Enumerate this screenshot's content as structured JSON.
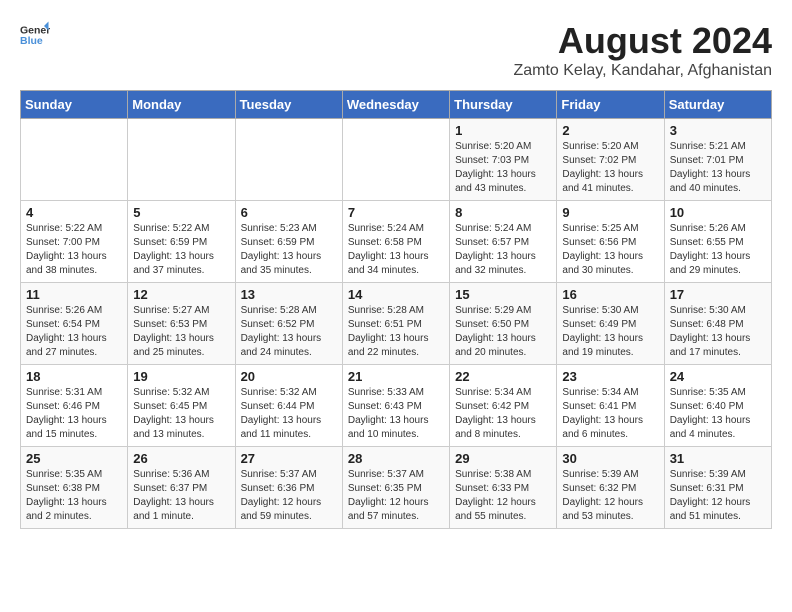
{
  "header": {
    "logo_general": "General",
    "logo_blue": "Blue",
    "title": "August 2024",
    "location": "Zamto Kelay, Kandahar, Afghanistan"
  },
  "weekdays": [
    "Sunday",
    "Monday",
    "Tuesday",
    "Wednesday",
    "Thursday",
    "Friday",
    "Saturday"
  ],
  "weeks": [
    [
      {
        "day": "",
        "info": ""
      },
      {
        "day": "",
        "info": ""
      },
      {
        "day": "",
        "info": ""
      },
      {
        "day": "",
        "info": ""
      },
      {
        "day": "1",
        "info": "Sunrise: 5:20 AM\nSunset: 7:03 PM\nDaylight: 13 hours\nand 43 minutes."
      },
      {
        "day": "2",
        "info": "Sunrise: 5:20 AM\nSunset: 7:02 PM\nDaylight: 13 hours\nand 41 minutes."
      },
      {
        "day": "3",
        "info": "Sunrise: 5:21 AM\nSunset: 7:01 PM\nDaylight: 13 hours\nand 40 minutes."
      }
    ],
    [
      {
        "day": "4",
        "info": "Sunrise: 5:22 AM\nSunset: 7:00 PM\nDaylight: 13 hours\nand 38 minutes."
      },
      {
        "day": "5",
        "info": "Sunrise: 5:22 AM\nSunset: 6:59 PM\nDaylight: 13 hours\nand 37 minutes."
      },
      {
        "day": "6",
        "info": "Sunrise: 5:23 AM\nSunset: 6:59 PM\nDaylight: 13 hours\nand 35 minutes."
      },
      {
        "day": "7",
        "info": "Sunrise: 5:24 AM\nSunset: 6:58 PM\nDaylight: 13 hours\nand 34 minutes."
      },
      {
        "day": "8",
        "info": "Sunrise: 5:24 AM\nSunset: 6:57 PM\nDaylight: 13 hours\nand 32 minutes."
      },
      {
        "day": "9",
        "info": "Sunrise: 5:25 AM\nSunset: 6:56 PM\nDaylight: 13 hours\nand 30 minutes."
      },
      {
        "day": "10",
        "info": "Sunrise: 5:26 AM\nSunset: 6:55 PM\nDaylight: 13 hours\nand 29 minutes."
      }
    ],
    [
      {
        "day": "11",
        "info": "Sunrise: 5:26 AM\nSunset: 6:54 PM\nDaylight: 13 hours\nand 27 minutes."
      },
      {
        "day": "12",
        "info": "Sunrise: 5:27 AM\nSunset: 6:53 PM\nDaylight: 13 hours\nand 25 minutes."
      },
      {
        "day": "13",
        "info": "Sunrise: 5:28 AM\nSunset: 6:52 PM\nDaylight: 13 hours\nand 24 minutes."
      },
      {
        "day": "14",
        "info": "Sunrise: 5:28 AM\nSunset: 6:51 PM\nDaylight: 13 hours\nand 22 minutes."
      },
      {
        "day": "15",
        "info": "Sunrise: 5:29 AM\nSunset: 6:50 PM\nDaylight: 13 hours\nand 20 minutes."
      },
      {
        "day": "16",
        "info": "Sunrise: 5:30 AM\nSunset: 6:49 PM\nDaylight: 13 hours\nand 19 minutes."
      },
      {
        "day": "17",
        "info": "Sunrise: 5:30 AM\nSunset: 6:48 PM\nDaylight: 13 hours\nand 17 minutes."
      }
    ],
    [
      {
        "day": "18",
        "info": "Sunrise: 5:31 AM\nSunset: 6:46 PM\nDaylight: 13 hours\nand 15 minutes."
      },
      {
        "day": "19",
        "info": "Sunrise: 5:32 AM\nSunset: 6:45 PM\nDaylight: 13 hours\nand 13 minutes."
      },
      {
        "day": "20",
        "info": "Sunrise: 5:32 AM\nSunset: 6:44 PM\nDaylight: 13 hours\nand 11 minutes."
      },
      {
        "day": "21",
        "info": "Sunrise: 5:33 AM\nSunset: 6:43 PM\nDaylight: 13 hours\nand 10 minutes."
      },
      {
        "day": "22",
        "info": "Sunrise: 5:34 AM\nSunset: 6:42 PM\nDaylight: 13 hours\nand 8 minutes."
      },
      {
        "day": "23",
        "info": "Sunrise: 5:34 AM\nSunset: 6:41 PM\nDaylight: 13 hours\nand 6 minutes."
      },
      {
        "day": "24",
        "info": "Sunrise: 5:35 AM\nSunset: 6:40 PM\nDaylight: 13 hours\nand 4 minutes."
      }
    ],
    [
      {
        "day": "25",
        "info": "Sunrise: 5:35 AM\nSunset: 6:38 PM\nDaylight: 13 hours\nand 2 minutes."
      },
      {
        "day": "26",
        "info": "Sunrise: 5:36 AM\nSunset: 6:37 PM\nDaylight: 13 hours\nand 1 minute."
      },
      {
        "day": "27",
        "info": "Sunrise: 5:37 AM\nSunset: 6:36 PM\nDaylight: 12 hours\nand 59 minutes."
      },
      {
        "day": "28",
        "info": "Sunrise: 5:37 AM\nSunset: 6:35 PM\nDaylight: 12 hours\nand 57 minutes."
      },
      {
        "day": "29",
        "info": "Sunrise: 5:38 AM\nSunset: 6:33 PM\nDaylight: 12 hours\nand 55 minutes."
      },
      {
        "day": "30",
        "info": "Sunrise: 5:39 AM\nSunset: 6:32 PM\nDaylight: 12 hours\nand 53 minutes."
      },
      {
        "day": "31",
        "info": "Sunrise: 5:39 AM\nSunset: 6:31 PM\nDaylight: 12 hours\nand 51 minutes."
      }
    ]
  ]
}
